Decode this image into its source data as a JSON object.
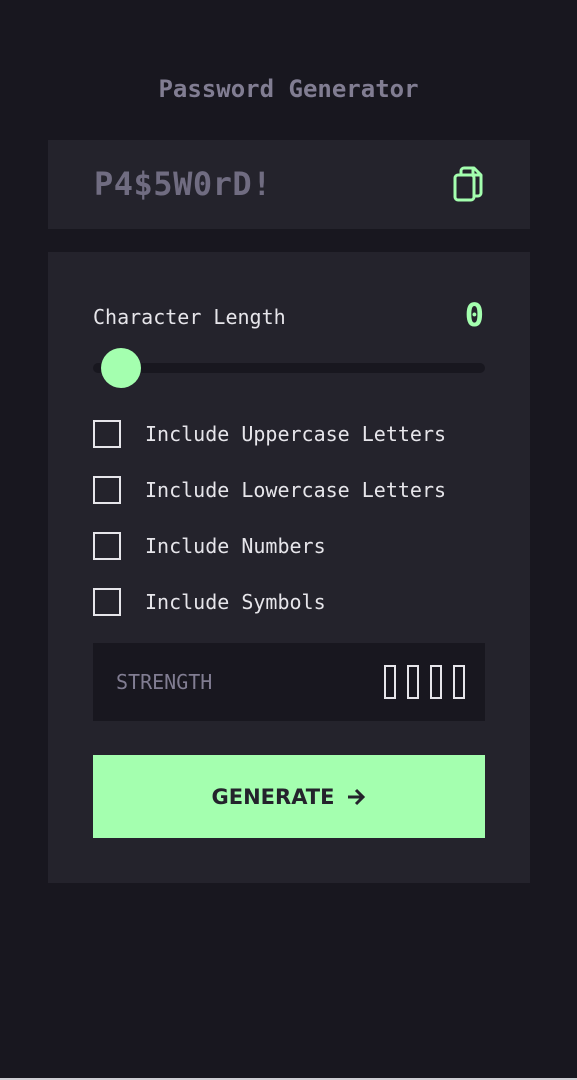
{
  "app": {
    "title": "Password Generator"
  },
  "password": {
    "value": "P4$5W0rD!",
    "copy_icon": "copy-icon"
  },
  "length": {
    "label": "Character Length",
    "value": "0"
  },
  "options": [
    {
      "label": "Include Uppercase Letters",
      "checked": false
    },
    {
      "label": "Include Lowercase Letters",
      "checked": false
    },
    {
      "label": "Include Numbers",
      "checked": false
    },
    {
      "label": "Include Symbols",
      "checked": false
    }
  ],
  "strength": {
    "label": "STRENGTH",
    "level": 0,
    "bars": 4
  },
  "generate": {
    "label": "GENERATE",
    "icon": "arrow-right-icon"
  },
  "colors": {
    "background": "#18171f",
    "panel": "#24232c",
    "accent": "#a4ffaf",
    "muted": "#817d92",
    "text": "#e6e5ea"
  }
}
